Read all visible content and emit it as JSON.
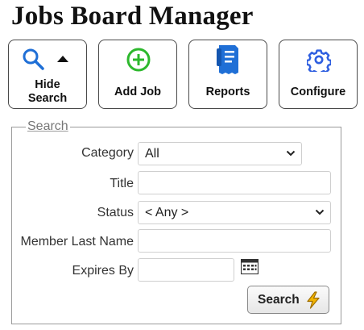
{
  "app": {
    "title": "Jobs Board Manager"
  },
  "toolbar": {
    "hide_search": {
      "line1": "Hide",
      "line2": "Search",
      "icons": [
        "search-icon",
        "caret-up-icon"
      ]
    },
    "add_job": {
      "label": "Add Job",
      "icon": "add-circle-icon",
      "color": "#2db82d"
    },
    "reports": {
      "label": "Reports",
      "icon": "document-icon",
      "color": "#1f6fd6"
    },
    "configure": {
      "label": "Configure",
      "icon": "gear-icon",
      "color": "#2f5fe0"
    }
  },
  "search": {
    "legend": "Search",
    "category": {
      "label": "Category",
      "value": "All"
    },
    "title": {
      "label": "Title",
      "value": ""
    },
    "status": {
      "label": "Status",
      "value": "< Any >"
    },
    "member_last_name": {
      "label": "Member Last Name",
      "value": ""
    },
    "expires_by": {
      "label": "Expires By",
      "value": "",
      "icon": "calendar-icon"
    },
    "submit": {
      "label": "Search",
      "icon": "lightning-icon",
      "icon_color": "#f2b400"
    }
  }
}
